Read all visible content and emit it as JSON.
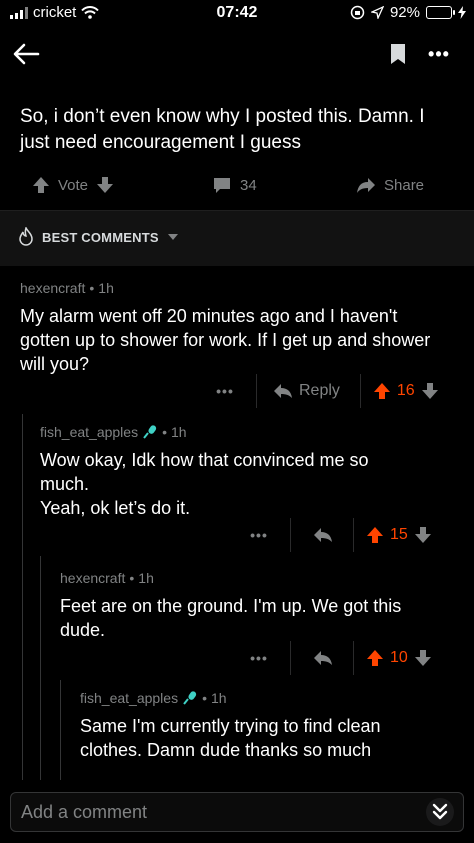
{
  "status_bar": {
    "carrier": "cricket",
    "time": "07:42",
    "battery": "92%",
    "battery_level": 0.92
  },
  "post": {
    "text": "So, i don’t even know why I posted this. Damn. I just need encouragement I guess",
    "vote_label": "Vote",
    "comment_count": "34",
    "share_label": "Share"
  },
  "sort": {
    "label": "BEST COMMENTS"
  },
  "comments": [
    {
      "author": "hexencraft",
      "age": "1h",
      "text": "My alarm went off 20 minutes ago and I haven't gotten up to shower for work. If I get up and shower will you?",
      "reply_label": "Reply",
      "score": "16"
    },
    {
      "author": "fish_eat_apples",
      "age": "1h",
      "text": "Wow okay, Idk how that convinced me so much.\nYeah, ok let’s do it.",
      "score": "15"
    },
    {
      "author": "hexencraft",
      "age": "1h",
      "text": "Feet are on the ground. I'm up. We got this dude.",
      "score": "10"
    },
    {
      "author": "fish_eat_apples",
      "age": "1h",
      "text": "Same I'm currently trying to find clean clothes. Damn dude thanks so much"
    }
  ],
  "comment_box": {
    "placeholder": "Add a comment"
  },
  "colors": {
    "background": "#000000",
    "upvote": "#ff4500",
    "muted": "#818384",
    "flair_mic": "#3fd1c5",
    "battery": "#4cd964"
  }
}
